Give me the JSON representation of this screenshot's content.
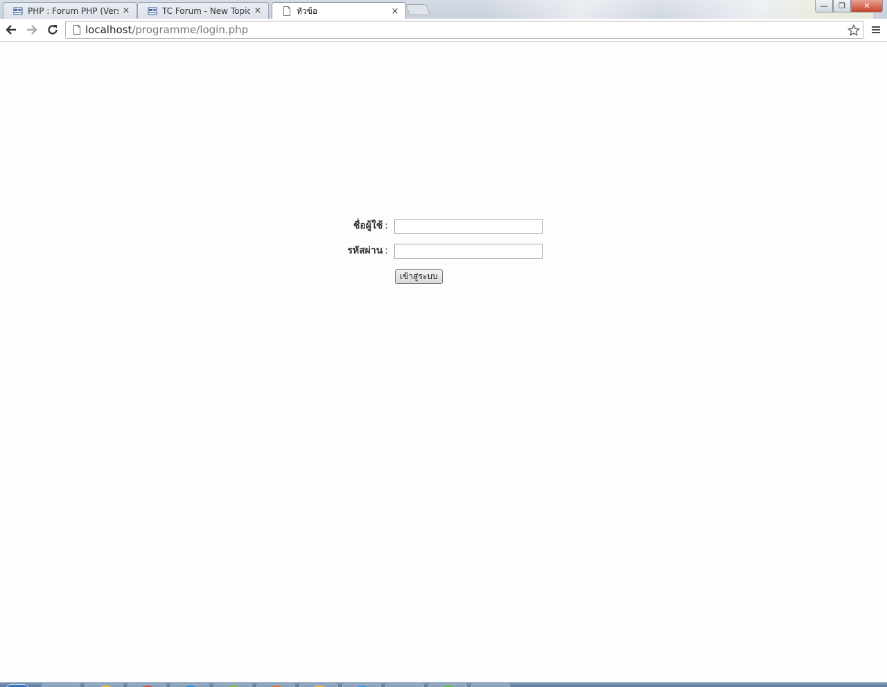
{
  "browser": {
    "tabs": [
      {
        "title": "PHP : Forum PHP (Version",
        "favicon": "forum-page-icon",
        "active": false
      },
      {
        "title": "TC Forum - New Topic :: a",
        "favicon": "forum-page-icon",
        "active": false
      },
      {
        "title": "หัวข้อ",
        "favicon": "blank-page-icon",
        "active": true
      }
    ],
    "close_glyph": "×",
    "url_host": "localhost",
    "url_path": "/programme/login.php",
    "window_controls": {
      "minimize": "—",
      "maximize": "❐",
      "close": "✕"
    }
  },
  "login": {
    "username_label": "ชื่อผู้ใช้",
    "password_label": "รหัสผ่าน",
    "colon": ":",
    "username_value": "",
    "password_value": "",
    "submit_label": "เข้าสู่ระบบ"
  },
  "colors": {
    "tabstrip": "#c9d0db",
    "page_background": "#fdfdfd",
    "taskbar": "#6b86a8",
    "close_button": "#c7432a"
  }
}
